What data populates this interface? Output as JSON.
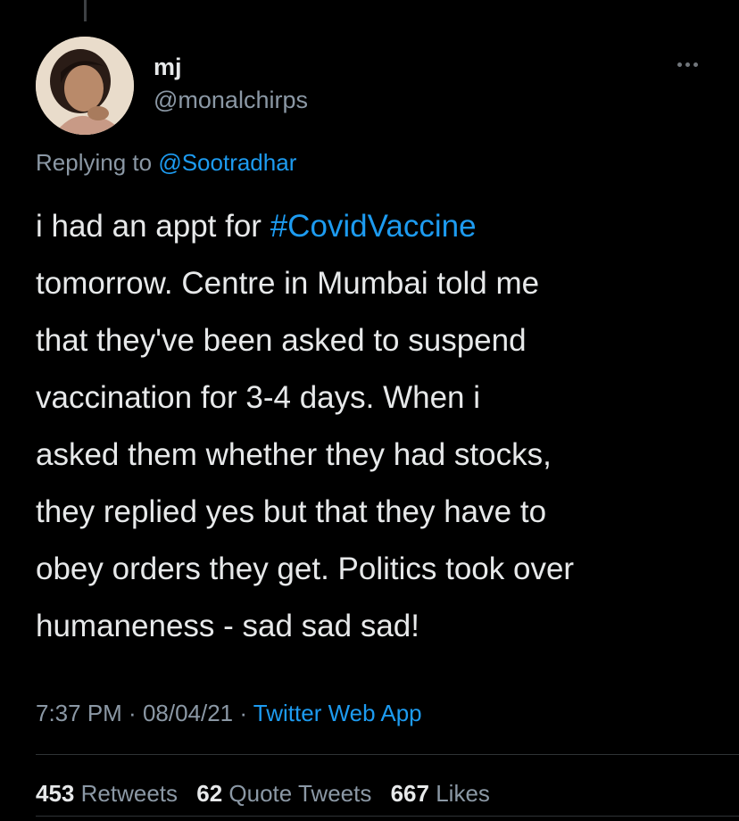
{
  "tweet": {
    "display_name": "mj",
    "handle": "@monalchirps",
    "replying_prefix": "Replying to ",
    "replying_to": "@Sootradhar",
    "text_lines": [
      {
        "before": "i had an appt for ",
        "hashtag": "#CovidVaccine",
        "after": ""
      },
      {
        "text": "tomorrow. Centre in Mumbai told me"
      },
      {
        "text": "that they've been asked to suspend"
      },
      {
        "text": "vaccination for 3-4 days. When i"
      },
      {
        "text": "asked them whether they had stocks,"
      },
      {
        "text": "they replied yes but that they have to"
      },
      {
        "text": "obey orders they get. Politics took over"
      },
      {
        "text": "humaneness - sad sad sad!"
      }
    ],
    "time": "7:37 PM",
    "separator": " · ",
    "date": "08/04/21",
    "source": "Twitter Web App"
  },
  "stats": {
    "retweets_count": "453",
    "retweets_label": "Retweets",
    "quotes_count": "62",
    "quotes_label": "Quote Tweets",
    "likes_count": "667",
    "likes_label": "Likes"
  },
  "icons": {
    "more": "more-horizontal-icon",
    "avatar": "profile-avatar"
  },
  "colors": {
    "background": "#000000",
    "text": "#e7e9ea",
    "secondary": "#8b98a5",
    "link": "#1d9bf0",
    "divider": "#2f3336"
  }
}
